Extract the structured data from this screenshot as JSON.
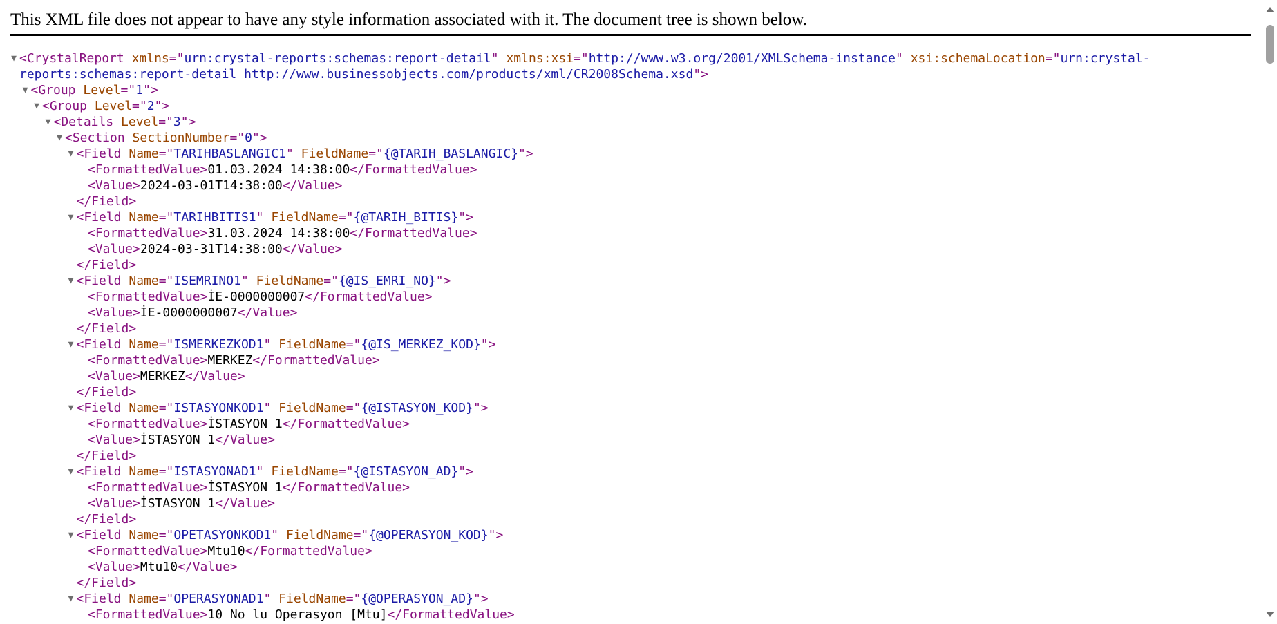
{
  "header": {
    "message": "This XML file does not appear to have any style information associated with it. The document tree is shown below."
  },
  "icons": {
    "collapse": "triangle-down-icon"
  },
  "colors": {
    "tag": "#881280",
    "attr_name": "#994500",
    "attr_value": "#1a1aa6",
    "text": "#000000"
  },
  "tree": [
    {
      "indent": 0,
      "toggle": true,
      "parts": [
        [
          "tag",
          "<CrystalReport "
        ],
        [
          "an",
          "xmlns"
        ],
        [
          "tag",
          "=\""
        ],
        [
          "av",
          "urn:crystal-reports:schemas:report-detail"
        ],
        [
          "tag",
          "\" "
        ],
        [
          "an",
          "xmlns:xsi"
        ],
        [
          "tag",
          "=\""
        ],
        [
          "av",
          "http://www.w3.org/2001/XMLSchema-instance"
        ],
        [
          "tag",
          "\" "
        ],
        [
          "an",
          "xsi:schemaLocation"
        ],
        [
          "tag",
          "=\""
        ],
        [
          "av",
          "urn:crystal-"
        ]
      ]
    },
    {
      "indent": 0,
      "toggle": false,
      "parts": [
        [
          "av",
          "reports:schemas:report-detail http://www.businessobjects.com/products/xml/CR2008Schema.xsd"
        ],
        [
          "tag",
          "\">"
        ]
      ]
    },
    {
      "indent": 1,
      "toggle": true,
      "parts": [
        [
          "tag",
          "<Group "
        ],
        [
          "an",
          "Level"
        ],
        [
          "tag",
          "=\""
        ],
        [
          "av",
          "1"
        ],
        [
          "tag",
          "\">"
        ]
      ]
    },
    {
      "indent": 2,
      "toggle": true,
      "parts": [
        [
          "tag",
          "<Group "
        ],
        [
          "an",
          "Level"
        ],
        [
          "tag",
          "=\""
        ],
        [
          "av",
          "2"
        ],
        [
          "tag",
          "\">"
        ]
      ]
    },
    {
      "indent": 3,
      "toggle": true,
      "parts": [
        [
          "tag",
          "<Details "
        ],
        [
          "an",
          "Level"
        ],
        [
          "tag",
          "=\""
        ],
        [
          "av",
          "3"
        ],
        [
          "tag",
          "\">"
        ]
      ]
    },
    {
      "indent": 4,
      "toggle": true,
      "parts": [
        [
          "tag",
          "<Section "
        ],
        [
          "an",
          "SectionNumber"
        ],
        [
          "tag",
          "=\""
        ],
        [
          "av",
          "0"
        ],
        [
          "tag",
          "\">"
        ]
      ]
    },
    {
      "indent": 5,
      "toggle": true,
      "parts": [
        [
          "tag",
          "<Field "
        ],
        [
          "an",
          "Name"
        ],
        [
          "tag",
          "=\""
        ],
        [
          "av",
          "TARIHBASLANGIC1"
        ],
        [
          "tag",
          "\" "
        ],
        [
          "an",
          "FieldName"
        ],
        [
          "tag",
          "=\""
        ],
        [
          "av",
          "{@TARIH_BASLANGIC}"
        ],
        [
          "tag",
          "\">"
        ]
      ]
    },
    {
      "indent": 6,
      "toggle": false,
      "parts": [
        [
          "tag",
          "<FormattedValue>"
        ],
        [
          "tx",
          "01.03.2024 14:38:00"
        ],
        [
          "tag",
          "</FormattedValue>"
        ]
      ]
    },
    {
      "indent": 6,
      "toggle": false,
      "parts": [
        [
          "tag",
          "<Value>"
        ],
        [
          "tx",
          "2024-03-01T14:38:00"
        ],
        [
          "tag",
          "</Value>"
        ]
      ]
    },
    {
      "indent": 5,
      "toggle": false,
      "parts": [
        [
          "tag",
          "</Field>"
        ]
      ]
    },
    {
      "indent": 5,
      "toggle": true,
      "parts": [
        [
          "tag",
          "<Field "
        ],
        [
          "an",
          "Name"
        ],
        [
          "tag",
          "=\""
        ],
        [
          "av",
          "TARIHBITIS1"
        ],
        [
          "tag",
          "\" "
        ],
        [
          "an",
          "FieldName"
        ],
        [
          "tag",
          "=\""
        ],
        [
          "av",
          "{@TARIH_BITIS}"
        ],
        [
          "tag",
          "\">"
        ]
      ]
    },
    {
      "indent": 6,
      "toggle": false,
      "parts": [
        [
          "tag",
          "<FormattedValue>"
        ],
        [
          "tx",
          "31.03.2024 14:38:00"
        ],
        [
          "tag",
          "</FormattedValue>"
        ]
      ]
    },
    {
      "indent": 6,
      "toggle": false,
      "parts": [
        [
          "tag",
          "<Value>"
        ],
        [
          "tx",
          "2024-03-31T14:38:00"
        ],
        [
          "tag",
          "</Value>"
        ]
      ]
    },
    {
      "indent": 5,
      "toggle": false,
      "parts": [
        [
          "tag",
          "</Field>"
        ]
      ]
    },
    {
      "indent": 5,
      "toggle": true,
      "parts": [
        [
          "tag",
          "<Field "
        ],
        [
          "an",
          "Name"
        ],
        [
          "tag",
          "=\""
        ],
        [
          "av",
          "ISEMRINO1"
        ],
        [
          "tag",
          "\" "
        ],
        [
          "an",
          "FieldName"
        ],
        [
          "tag",
          "=\""
        ],
        [
          "av",
          "{@IS_EMRI_NO}"
        ],
        [
          "tag",
          "\">"
        ]
      ]
    },
    {
      "indent": 6,
      "toggle": false,
      "parts": [
        [
          "tag",
          "<FormattedValue>"
        ],
        [
          "tx",
          "İE-0000000007"
        ],
        [
          "tag",
          "</FormattedValue>"
        ]
      ]
    },
    {
      "indent": 6,
      "toggle": false,
      "parts": [
        [
          "tag",
          "<Value>"
        ],
        [
          "tx",
          "İE-0000000007"
        ],
        [
          "tag",
          "</Value>"
        ]
      ]
    },
    {
      "indent": 5,
      "toggle": false,
      "parts": [
        [
          "tag",
          "</Field>"
        ]
      ]
    },
    {
      "indent": 5,
      "toggle": true,
      "parts": [
        [
          "tag",
          "<Field "
        ],
        [
          "an",
          "Name"
        ],
        [
          "tag",
          "=\""
        ],
        [
          "av",
          "ISMERKEZKOD1"
        ],
        [
          "tag",
          "\" "
        ],
        [
          "an",
          "FieldName"
        ],
        [
          "tag",
          "=\""
        ],
        [
          "av",
          "{@IS_MERKEZ_KOD}"
        ],
        [
          "tag",
          "\">"
        ]
      ]
    },
    {
      "indent": 6,
      "toggle": false,
      "parts": [
        [
          "tag",
          "<FormattedValue>"
        ],
        [
          "tx",
          "MERKEZ"
        ],
        [
          "tag",
          "</FormattedValue>"
        ]
      ]
    },
    {
      "indent": 6,
      "toggle": false,
      "parts": [
        [
          "tag",
          "<Value>"
        ],
        [
          "tx",
          "MERKEZ"
        ],
        [
          "tag",
          "</Value>"
        ]
      ]
    },
    {
      "indent": 5,
      "toggle": false,
      "parts": [
        [
          "tag",
          "</Field>"
        ]
      ]
    },
    {
      "indent": 5,
      "toggle": true,
      "parts": [
        [
          "tag",
          "<Field "
        ],
        [
          "an",
          "Name"
        ],
        [
          "tag",
          "=\""
        ],
        [
          "av",
          "ISTASYONKOD1"
        ],
        [
          "tag",
          "\" "
        ],
        [
          "an",
          "FieldName"
        ],
        [
          "tag",
          "=\""
        ],
        [
          "av",
          "{@ISTASYON_KOD}"
        ],
        [
          "tag",
          "\">"
        ]
      ]
    },
    {
      "indent": 6,
      "toggle": false,
      "parts": [
        [
          "tag",
          "<FormattedValue>"
        ],
        [
          "tx",
          "İSTASYON 1"
        ],
        [
          "tag",
          "</FormattedValue>"
        ]
      ]
    },
    {
      "indent": 6,
      "toggle": false,
      "parts": [
        [
          "tag",
          "<Value>"
        ],
        [
          "tx",
          "İSTASYON 1"
        ],
        [
          "tag",
          "</Value>"
        ]
      ]
    },
    {
      "indent": 5,
      "toggle": false,
      "parts": [
        [
          "tag",
          "</Field>"
        ]
      ]
    },
    {
      "indent": 5,
      "toggle": true,
      "parts": [
        [
          "tag",
          "<Field "
        ],
        [
          "an",
          "Name"
        ],
        [
          "tag",
          "=\""
        ],
        [
          "av",
          "ISTASYONAD1"
        ],
        [
          "tag",
          "\" "
        ],
        [
          "an",
          "FieldName"
        ],
        [
          "tag",
          "=\""
        ],
        [
          "av",
          "{@ISTASYON_AD}"
        ],
        [
          "tag",
          "\">"
        ]
      ]
    },
    {
      "indent": 6,
      "toggle": false,
      "parts": [
        [
          "tag",
          "<FormattedValue>"
        ],
        [
          "tx",
          "İSTASYON 1"
        ],
        [
          "tag",
          "</FormattedValue>"
        ]
      ]
    },
    {
      "indent": 6,
      "toggle": false,
      "parts": [
        [
          "tag",
          "<Value>"
        ],
        [
          "tx",
          "İSTASYON 1"
        ],
        [
          "tag",
          "</Value>"
        ]
      ]
    },
    {
      "indent": 5,
      "toggle": false,
      "parts": [
        [
          "tag",
          "</Field>"
        ]
      ]
    },
    {
      "indent": 5,
      "toggle": true,
      "parts": [
        [
          "tag",
          "<Field "
        ],
        [
          "an",
          "Name"
        ],
        [
          "tag",
          "=\""
        ],
        [
          "av",
          "OPETASYONKOD1"
        ],
        [
          "tag",
          "\" "
        ],
        [
          "an",
          "FieldName"
        ],
        [
          "tag",
          "=\""
        ],
        [
          "av",
          "{@OPERASYON_KOD}"
        ],
        [
          "tag",
          "\">"
        ]
      ]
    },
    {
      "indent": 6,
      "toggle": false,
      "parts": [
        [
          "tag",
          "<FormattedValue>"
        ],
        [
          "tx",
          "Mtu10"
        ],
        [
          "tag",
          "</FormattedValue>"
        ]
      ]
    },
    {
      "indent": 6,
      "toggle": false,
      "parts": [
        [
          "tag",
          "<Value>"
        ],
        [
          "tx",
          "Mtu10"
        ],
        [
          "tag",
          "</Value>"
        ]
      ]
    },
    {
      "indent": 5,
      "toggle": false,
      "parts": [
        [
          "tag",
          "</Field>"
        ]
      ]
    },
    {
      "indent": 5,
      "toggle": true,
      "parts": [
        [
          "tag",
          "<Field "
        ],
        [
          "an",
          "Name"
        ],
        [
          "tag",
          "=\""
        ],
        [
          "av",
          "OPERASYONAD1"
        ],
        [
          "tag",
          "\" "
        ],
        [
          "an",
          "FieldName"
        ],
        [
          "tag",
          "=\""
        ],
        [
          "av",
          "{@OPERASYON_AD}"
        ],
        [
          "tag",
          "\">"
        ]
      ]
    },
    {
      "indent": 6,
      "toggle": false,
      "parts": [
        [
          "tag",
          "<FormattedValue>"
        ],
        [
          "tx",
          "10 No lu Operasyon [Mtu]"
        ],
        [
          "tag",
          "</FormattedValue>"
        ]
      ]
    }
  ]
}
